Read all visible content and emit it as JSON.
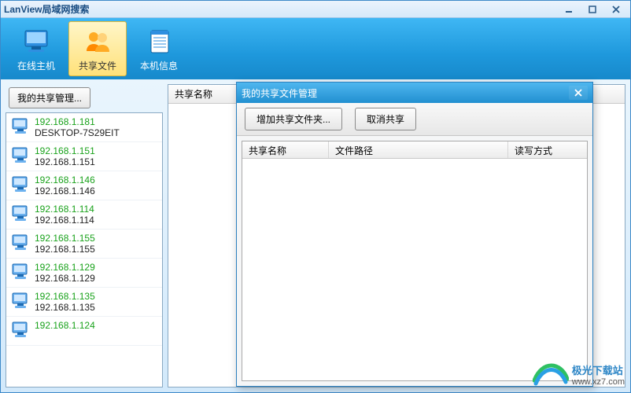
{
  "window": {
    "title": "LanView局域网搜索"
  },
  "toolbar": {
    "items": [
      {
        "label": "在线主机",
        "icon": "monitor"
      },
      {
        "label": "共享文件",
        "icon": "users",
        "selected": true
      },
      {
        "label": "本机信息",
        "icon": "notepad"
      }
    ]
  },
  "share_mgmt_button": "我的共享管理...",
  "hosts": [
    {
      "ip": "192.168.1.181",
      "name": "DESKTOP-7S29EIT"
    },
    {
      "ip": "192.168.1.151",
      "name": "192.168.1.151"
    },
    {
      "ip": "192.168.1.146",
      "name": "192.168.1.146"
    },
    {
      "ip": "192.168.1.114",
      "name": "192.168.1.114"
    },
    {
      "ip": "192.168.1.155",
      "name": "192.168.1.155"
    },
    {
      "ip": "192.168.1.129",
      "name": "192.168.1.129"
    },
    {
      "ip": "192.168.1.135",
      "name": "192.168.1.135"
    },
    {
      "ip": "192.168.1.124",
      "name": ""
    }
  ],
  "right_panel": {
    "columns": [
      "共享名称"
    ]
  },
  "dialog": {
    "title": "我的共享文件管理",
    "buttons": {
      "add": "增加共享文件夹...",
      "remove": "取消共享"
    },
    "columns": [
      "共享名称",
      "文件路径",
      "读写方式"
    ]
  },
  "watermark": {
    "name": "极光下载站",
    "url": "www.xz7.com"
  }
}
